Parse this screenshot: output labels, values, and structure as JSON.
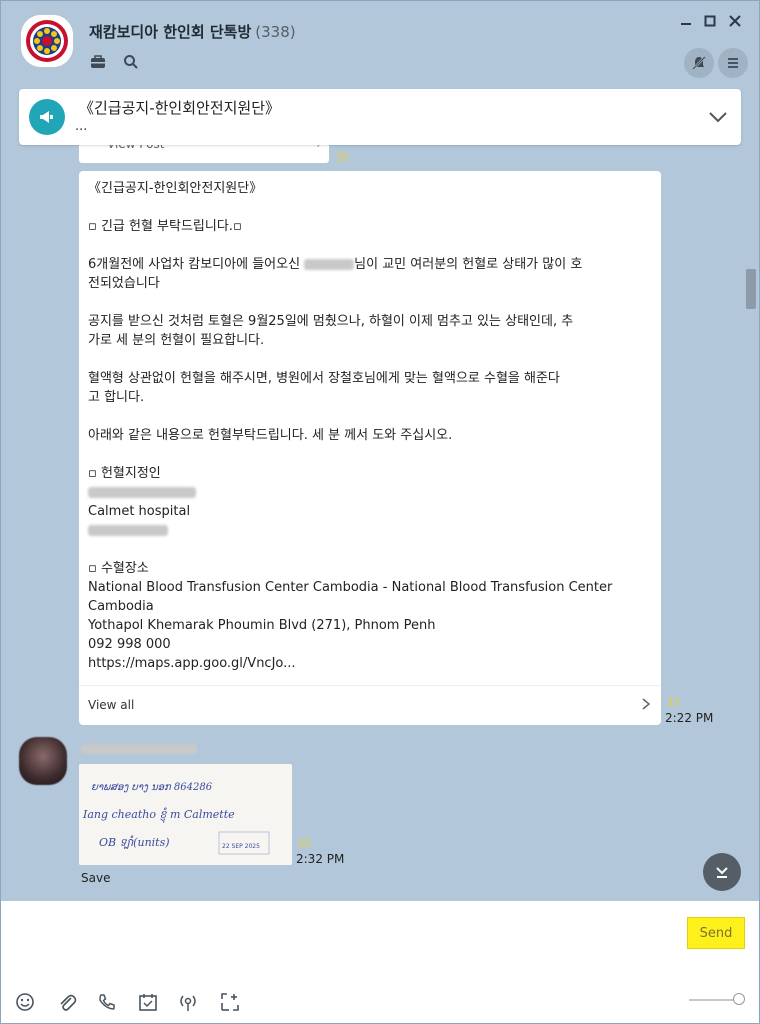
{
  "header": {
    "title": "재캄보디아 한인회 단톡방",
    "member_count": "(338)",
    "icons": [
      "briefcase-icon",
      "search-icon",
      "notification-off-icon",
      "menu-icon",
      "minimize-icon",
      "maximize-icon",
      "close-icon"
    ]
  },
  "notice": {
    "title": "《긴급공지-한인회안전지원단》",
    "sub": "..."
  },
  "partial_card": {
    "label": "View Post",
    "count": "35"
  },
  "post": {
    "lines": [
      "《긴급공지-한인회안전지원단》",
      "▫ 긴급 헌혈 부탁드립니다.▫",
      "6개월전에 사업차 캄보디아에 들어오신 ",
      "님이 교민 여러분의 헌혈로 상태가 많이 호",
      "전되었습니다",
      "공지를 받으신 것처럼 토혈은 9월25일에 멈췄으나, 하혈이 이제 멈추고 있는 상태인데, 추",
      "가로 세 분의 헌혈이 필요합니다.",
      "혈액형 상관없이 헌혈을 해주시면, 병원에서 장철호님에게 맞는 혈액으로 수혈을 해준다",
      "고 합니다.",
      "아래와 같은 내용으로 헌혈부탁드립니다. 세 분 께서 도와 주십시오.",
      "▫ 헌혈지정인",
      "Calmet hospital",
      "▫ 수혈장소",
      "National Blood Transfusion Center Cambodia - National Blood Transfusion Center",
      "Cambodia",
      "Yothapol Khemarak Phoumin Blvd (271), Phnom Penh",
      "092 998 000",
      "https://maps.app.goo.gl/VncJo..."
    ],
    "view_all": "View all",
    "count": "35",
    "time": "2:22 PM"
  },
  "photo_message": {
    "handwriting_line1": "ຍາພສອງ ບາງ ນອກ 864286",
    "handwriting_line2": "Iang cheatho ខ្ញុំ m Calmette",
    "handwriting_line3": "OB ទ្បាំ(units)",
    "stamp": "22 SEP 2025",
    "count": "35",
    "time": "2:32 PM",
    "save_label": "Save"
  },
  "composer": {
    "placeholder": "",
    "send_label": "Send",
    "tools": [
      "emoji-icon",
      "attach-icon",
      "call-icon",
      "calendar-icon",
      "broadcast-icon",
      "screenshot-icon"
    ]
  },
  "colors": {
    "background": "#b2c7d9",
    "send_button": "#fef01b",
    "notice_icon": "#21a6b8",
    "count": "#e8d03a"
  }
}
